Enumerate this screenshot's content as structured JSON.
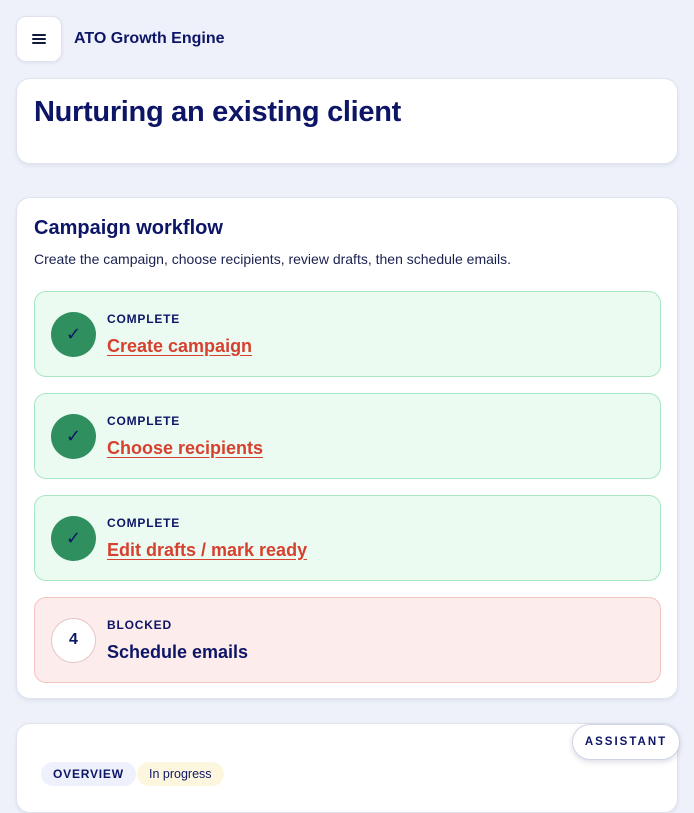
{
  "header": {
    "app_title": "ATO Growth Engine"
  },
  "page": {
    "title": "Nurturing an existing client"
  },
  "workflow": {
    "title": "Campaign workflow",
    "subtitle": "Create the campaign, choose recipients, review drafts, then schedule emails.",
    "steps": [
      {
        "status": "COMPLETE",
        "label": "Create campaign",
        "badge": "✓"
      },
      {
        "status": "COMPLETE",
        "label": "Choose recipients",
        "badge": "✓"
      },
      {
        "status": "COMPLETE",
        "label": "Edit drafts / mark ready",
        "badge": "✓"
      },
      {
        "status": "BLOCKED",
        "label": "Schedule emails",
        "badge": "4"
      }
    ]
  },
  "overview": {
    "tag": "OVERVIEW",
    "status": "In progress"
  },
  "assistant": {
    "label": "ASSISTANT"
  },
  "colors": {
    "primary_text": "#0d1566",
    "link": "#d6412f",
    "complete_bg": "#ecfbf2",
    "complete_badge": "#2f8f5f",
    "blocked_bg": "#fdecec"
  }
}
